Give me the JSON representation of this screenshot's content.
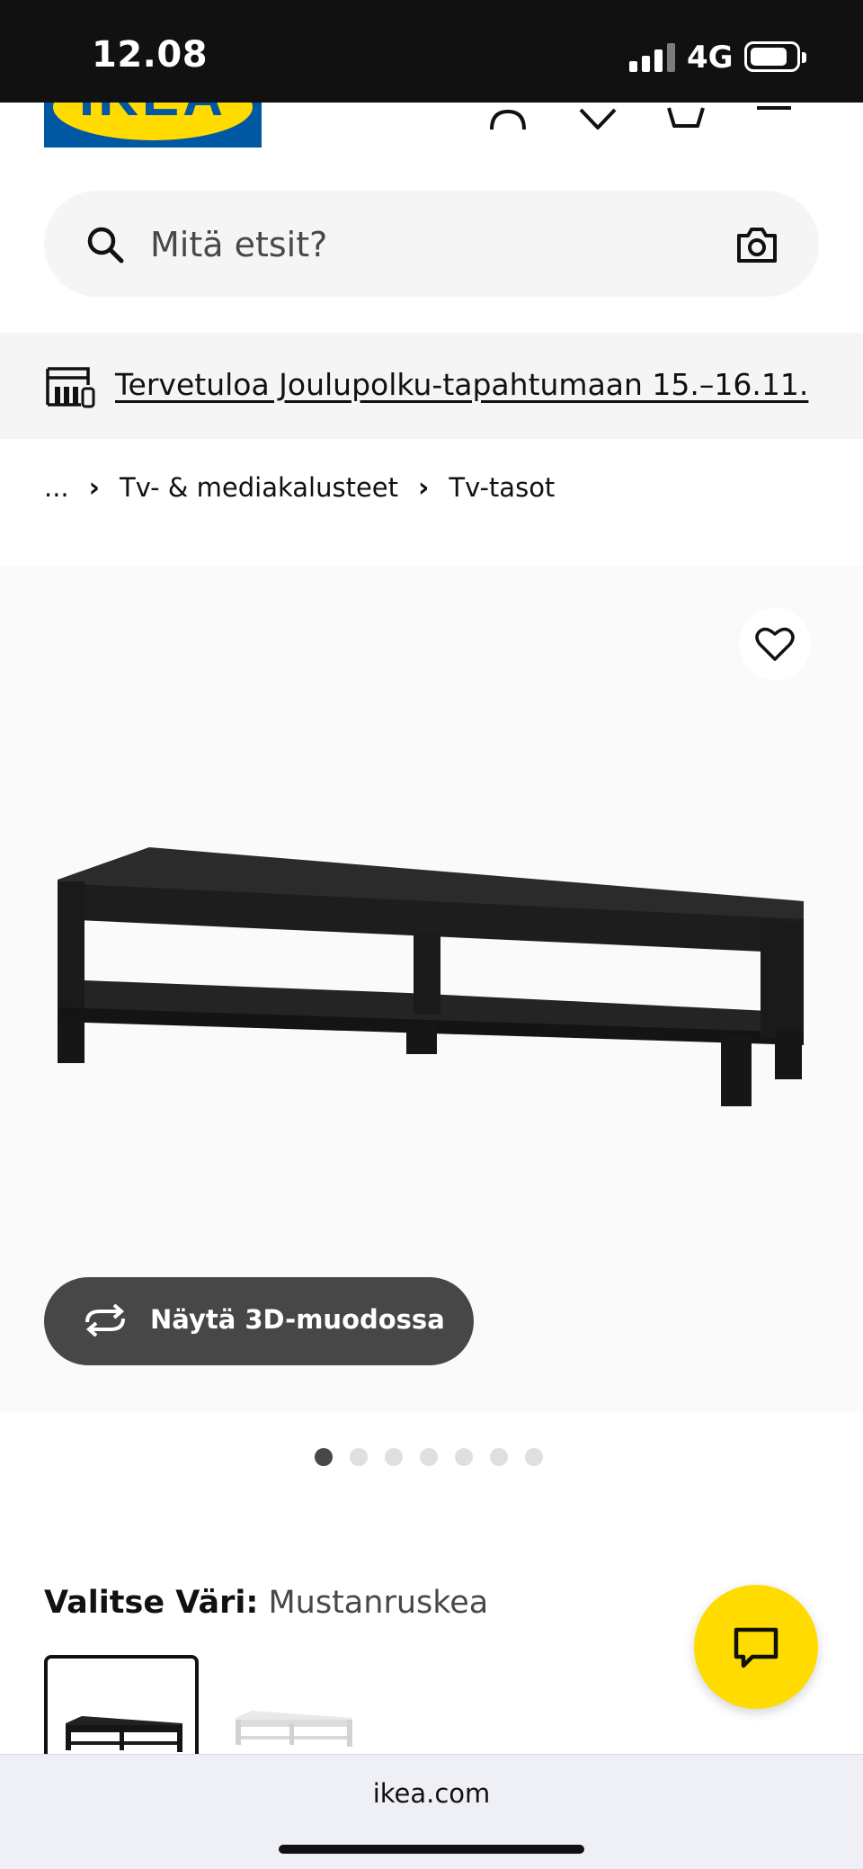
{
  "status_bar": {
    "time": "12.08",
    "network": "4G"
  },
  "header": {
    "logo_text": "IKEA"
  },
  "search": {
    "placeholder": "Mitä etsit?"
  },
  "banner": {
    "text": "Tervetuloa Joulupolku-tapahtumaan 15.–16.11."
  },
  "breadcrumb": {
    "ellipsis": "...",
    "items": [
      "Tv- & mediakalusteet",
      "Tv-tasot"
    ]
  },
  "gallery": {
    "view_3d_label": "Näytä 3D-muodossa",
    "image_count": 7,
    "active_index": 0
  },
  "color_select": {
    "label": "Valitse Väri:",
    "value": "Mustanruskea",
    "options": [
      "Mustanruskea",
      "Valkoinen"
    ]
  },
  "browser": {
    "url": "ikea.com"
  },
  "colors": {
    "brand_blue": "#0058a3",
    "brand_yellow": "#ffdb00",
    "dark_button": "#474747"
  },
  "icons": [
    "search-icon",
    "camera-icon",
    "store-icon",
    "heart-icon",
    "rotate-3d-icon",
    "chat-icon",
    "account-icon",
    "cart-icon",
    "menu-icon"
  ]
}
